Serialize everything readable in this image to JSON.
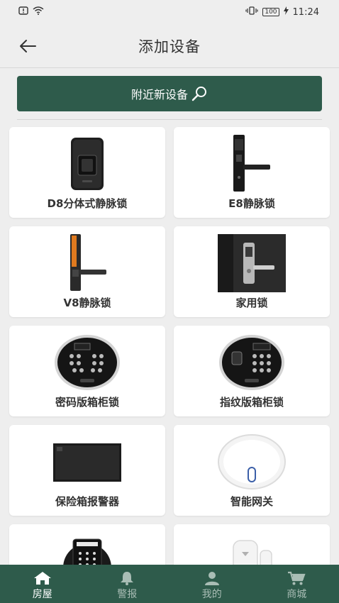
{
  "status_bar": {
    "battery": "100",
    "time": "11:24"
  },
  "header": {
    "title": "添加设备"
  },
  "nearby": {
    "label": "附近新设备"
  },
  "devices": [
    {
      "label": "D8分体式静脉锁",
      "icon": "split-vein-lock-icon"
    },
    {
      "label": "E8静脉锁",
      "icon": "handle-vein-lock-icon"
    },
    {
      "label": "V8静脉锁",
      "icon": "handle-vein-lock-orange-icon"
    },
    {
      "label": "家用锁",
      "icon": "home-door-lock-icon"
    },
    {
      "label": "密码版箱柜锁",
      "icon": "keypad-safe-lock-icon"
    },
    {
      "label": "指纹版箱柜锁",
      "icon": "fingerprint-safe-lock-icon"
    },
    {
      "label": "保险箱报警器",
      "icon": "safe-alarm-icon"
    },
    {
      "label": "智能网关",
      "icon": "smart-gateway-icon"
    },
    {
      "label": "",
      "icon": "round-keypad-lock-icon"
    },
    {
      "label": "",
      "icon": "door-sensor-icon"
    }
  ],
  "nav": [
    {
      "label": "房屋",
      "icon": "home-icon",
      "active": true
    },
    {
      "label": "警报",
      "icon": "bell-icon",
      "active": false
    },
    {
      "label": "我的",
      "icon": "person-icon",
      "active": false
    },
    {
      "label": "商城",
      "icon": "cart-icon",
      "active": false
    }
  ]
}
